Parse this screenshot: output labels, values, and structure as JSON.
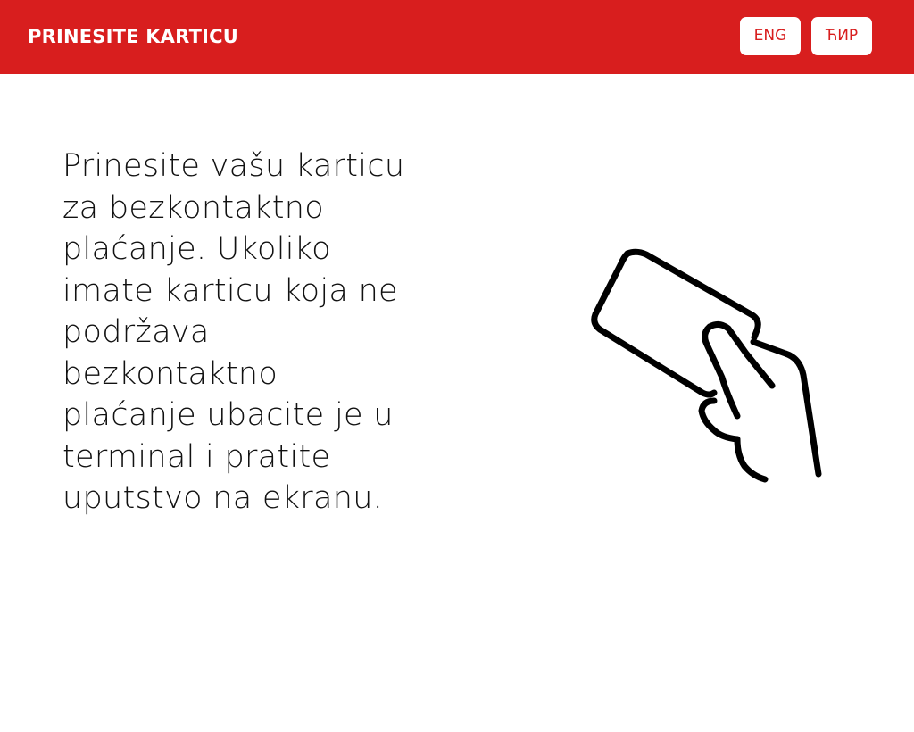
{
  "header": {
    "title": "PRINESITE KARTICU",
    "background_color": "#d81e1e"
  },
  "languages": [
    {
      "label": "ENG"
    },
    {
      "label": "ЋИР"
    }
  ],
  "main": {
    "message_lines": [
      "Prinesite vašu karticu",
      "za bezkontaktno",
      "plaćanje. Ukoliko",
      "imate karticu koja ne",
      "podržava",
      "bezkontaktno",
      "plaćanje ubacite je u",
      "terminal i pratite",
      "uputstvo na ekranu."
    ],
    "illustration_icon": "hand-holding-card-icon"
  }
}
